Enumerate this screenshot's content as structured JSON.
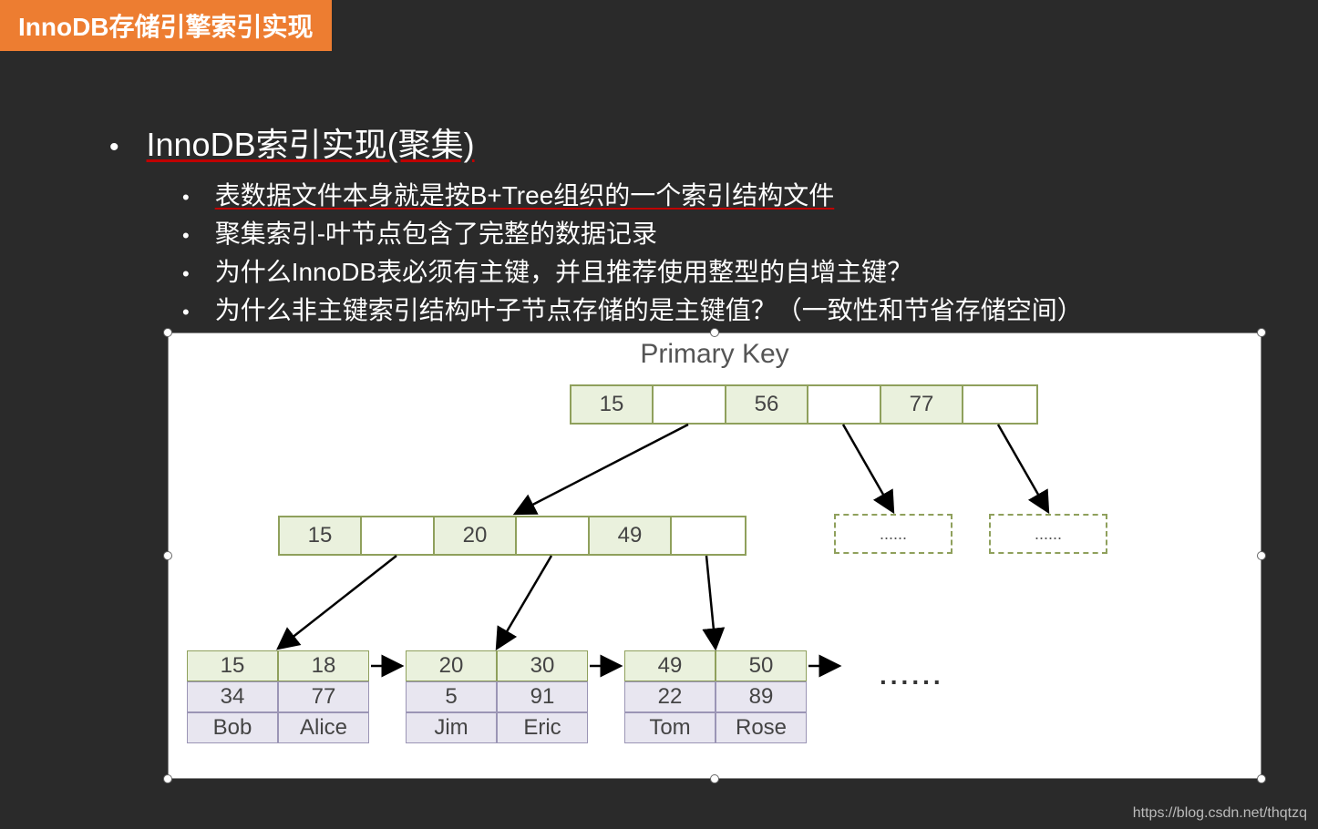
{
  "header": {
    "title": "InnoDB存储引擎索引实现"
  },
  "bullets": {
    "main": "InnoDB索引实现(聚集)",
    "subs": [
      "表数据文件本身就是按B+Tree组织的一个索引结构文件",
      "聚集索引-叶节点包含了完整的数据记录",
      "为什么InnoDB表必须有主键，并且推荐使用整型的自增主键？",
      "为什么非主键索引结构叶子节点存储的是主键值？（一致性和节省存储空间）"
    ]
  },
  "diagram": {
    "title": "Primary Key",
    "root_keys": [
      "15",
      "56",
      "77"
    ],
    "mid_keys": [
      "15",
      "20",
      "49"
    ],
    "leaves": [
      {
        "keys": [
          "15",
          "18"
        ],
        "data1": [
          "34",
          "77"
        ],
        "data2": [
          "Bob",
          "Alice"
        ]
      },
      {
        "keys": [
          "20",
          "30"
        ],
        "data1": [
          "5",
          "91"
        ],
        "data2": [
          "Jim",
          "Eric"
        ]
      },
      {
        "keys": [
          "49",
          "50"
        ],
        "data1": [
          "22",
          "89"
        ],
        "data2": [
          "Tom",
          "Rose"
        ]
      }
    ],
    "ellipsis_small": "......",
    "ellipsis_large": "......"
  },
  "watermark": "https://blog.csdn.net/thqtzq"
}
